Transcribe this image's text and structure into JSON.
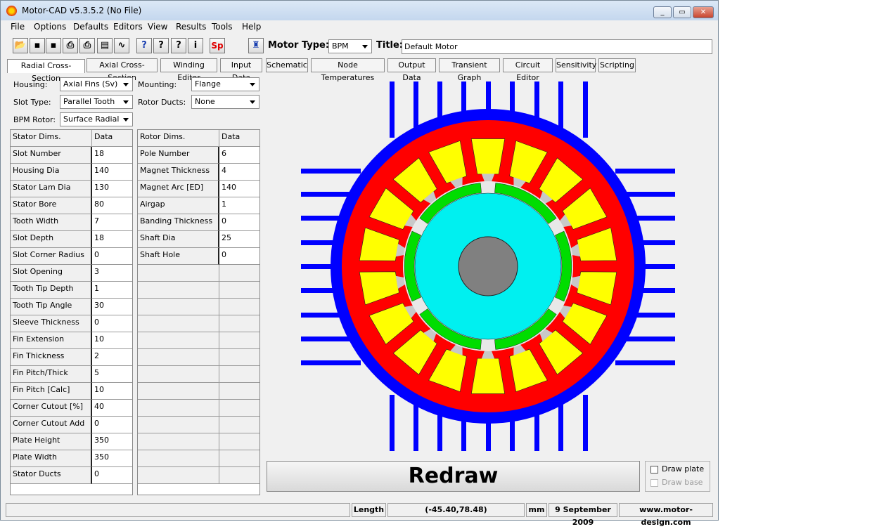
{
  "window": {
    "title": "Motor-CAD v5.3.5.2 (No File)"
  },
  "menu": [
    "File",
    "Options",
    "Defaults",
    "Editors",
    "View",
    "Results",
    "Tools",
    "Help"
  ],
  "toolbar": {
    "motor_type_label": "Motor Type:",
    "motor_type_value": "BPM",
    "title_label": "Title:",
    "title_value": "Default Motor",
    "sp_label": "Sp"
  },
  "tabs": [
    "Radial Cross-Section",
    "Axial Cross-Section",
    "Winding Editor",
    "Input Data",
    "Schematic",
    "Node Temperatures",
    "Output Data",
    "Transient Graph",
    "Circuit Editor",
    "Sensitivity",
    "Scripting"
  ],
  "options": {
    "housing_label": "Housing:",
    "housing_value": "Axial Fins (Sv)",
    "slot_type_label": "Slot Type:",
    "slot_type_value": "Parallel Tooth",
    "bpm_rotor_label": "BPM Rotor:",
    "bpm_rotor_value": "Surface Radial",
    "mounting_label": "Mounting:",
    "mounting_value": "Flange",
    "rotor_ducts_label": "Rotor Ducts:",
    "rotor_ducts_value": "None"
  },
  "stator_table": {
    "header": [
      "Stator Dims.",
      "Data"
    ],
    "rows": [
      [
        "Slot Number",
        "18"
      ],
      [
        "Housing Dia",
        "140"
      ],
      [
        "Stator Lam Dia",
        "130"
      ],
      [
        "Stator Bore",
        "80"
      ],
      [
        "Tooth Width",
        "7"
      ],
      [
        "Slot Depth",
        "18"
      ],
      [
        "Slot Corner Radius",
        "0"
      ],
      [
        "Slot Opening",
        "3"
      ],
      [
        "Tooth Tip Depth",
        "1"
      ],
      [
        "Tooth Tip Angle",
        "30"
      ],
      [
        "Sleeve Thickness",
        "0"
      ],
      [
        "Fin Extension",
        "10"
      ],
      [
        "Fin Thickness",
        "2"
      ],
      [
        "Fin Pitch/Thick",
        "5"
      ],
      [
        "Fin Pitch [Calc]",
        "10"
      ],
      [
        "Corner Cutout [%]",
        "40"
      ],
      [
        "Corner Cutout Add",
        "0"
      ],
      [
        "Plate Height",
        "350"
      ],
      [
        "Plate Width",
        "350"
      ],
      [
        "Stator Ducts",
        "0"
      ]
    ]
  },
  "rotor_table": {
    "header": [
      "Rotor Dims.",
      "Data"
    ],
    "rows": [
      [
        "Pole Number",
        "6"
      ],
      [
        "Magnet Thickness",
        "4"
      ],
      [
        "Magnet Arc [ED]",
        "140"
      ],
      [
        "Airgap",
        "1"
      ],
      [
        "Banding Thickness",
        "0"
      ],
      [
        "Shaft Dia",
        "25"
      ],
      [
        "Shaft Hole Diameter",
        "0"
      ]
    ]
  },
  "redraw_label": "Redraw",
  "draw_plate_label": "Draw plate",
  "draw_base_label": "Draw base",
  "status": {
    "unit_label": "Length",
    "coords": "(-45.40,78.48)",
    "unit": "mm",
    "date": "9 September 2009",
    "website": "www.motor-design.com"
  },
  "colors": {
    "housing": "#0000ff",
    "stator": "#ff0000",
    "winding": "#ffff00",
    "magnet": "#00dd00",
    "rotor": "#00f0f0",
    "shaft": "#808080"
  }
}
